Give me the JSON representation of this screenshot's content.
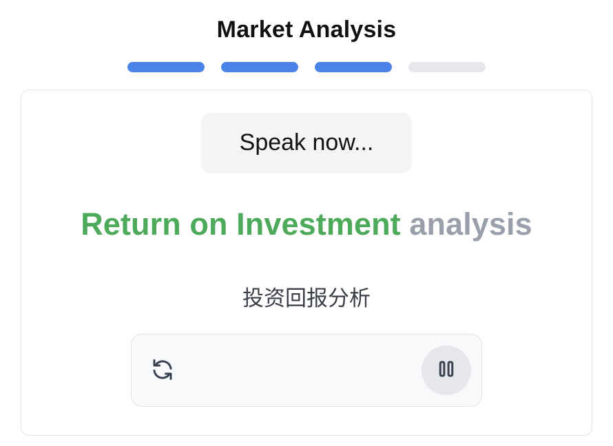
{
  "header": {
    "title": "Market Analysis"
  },
  "progress": {
    "total_steps": 4,
    "completed_steps": 3,
    "active_color": "#4b82e6",
    "inactive_color": "#e5e7eb"
  },
  "card": {
    "speak_button_label": "Speak now...",
    "phrase": {
      "spoken": "Return on Investment",
      "pending": "analysis",
      "spoken_color": "#4caa5a",
      "pending_color": "#9aa0ab"
    },
    "translation": "投资回报分析"
  },
  "controls": {
    "refresh_icon": "refresh-icon",
    "pause_icon": "pause-icon"
  }
}
